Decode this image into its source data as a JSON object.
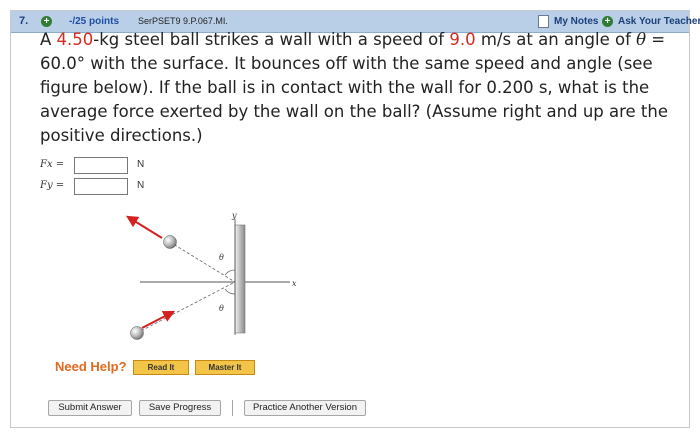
{
  "header": {
    "question_number": "7.",
    "points_label": "-/25 points",
    "problem_code": "SerPSET9 9.P.067.MI.",
    "my_notes_label": "My Notes",
    "ask_teacher_label": "Ask Your Teacher"
  },
  "question": {
    "p1": "A ",
    "mass": "4.50",
    "p2": "-kg steel ball strikes a wall with a speed of ",
    "speed": "9.0",
    "p3": " m/s at an angle of ",
    "theta_symbol": "θ",
    "p4": " = 60.0° with the surface. It bounces off with the same speed and angle (see figure below). If the ball is in contact with the wall for 0.200 s, what is the average force exerted by the wall on the ball? (Assume right and up are the positive directions.)"
  },
  "answers": [
    {
      "label": "Fx =",
      "value": "",
      "unit": "N"
    },
    {
      "label": "Fy =",
      "value": "",
      "unit": "N"
    }
  ],
  "figure": {
    "axis_y_label": "y",
    "axis_x_label": "x",
    "theta_top": "θ",
    "theta_bottom": "θ"
  },
  "help": {
    "label": "Need Help?",
    "read_it": "Read It",
    "master_it": "Master It"
  },
  "footer": {
    "submit": "Submit Answer",
    "save": "Save Progress",
    "practice": "Practice Another Version"
  },
  "colors": {
    "header_bg": "#b9cfe8",
    "highlight_red": "#d42b1e",
    "arrow_red": "#d32020",
    "help_orange": "#e06a1d",
    "help_button": "#f2c447"
  }
}
